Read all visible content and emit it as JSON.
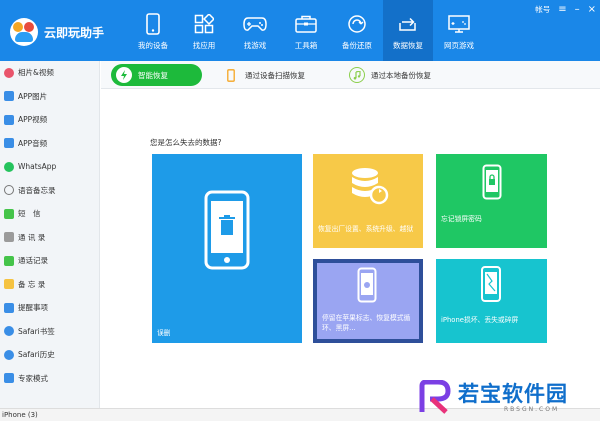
{
  "app": {
    "title": "云即玩助手"
  },
  "window": {
    "account_label": "帐号"
  },
  "nav": [
    {
      "label": "我的设备",
      "icon": "phone-icon"
    },
    {
      "label": "找应用",
      "icon": "apps-icon"
    },
    {
      "label": "找游戏",
      "icon": "gamepad-icon"
    },
    {
      "label": "工具箱",
      "icon": "toolbox-icon"
    },
    {
      "label": "备份还原",
      "icon": "backup-icon"
    },
    {
      "label": "数据恢复",
      "icon": "recover-icon"
    },
    {
      "label": "网页游戏",
      "icon": "monitor-icon"
    }
  ],
  "sidebar": [
    {
      "label": "相片&视频",
      "color": "#e9546b"
    },
    {
      "label": "APP图片",
      "color": "#3a8ee6"
    },
    {
      "label": "APP视频",
      "color": "#3a8ee6"
    },
    {
      "label": "APP音频",
      "color": "#3a8ee6"
    },
    {
      "label": "WhatsApp",
      "color": "#25c35d"
    },
    {
      "label": "语音备忘录",
      "color": "#777777"
    },
    {
      "label": "短　信",
      "color": "#45c44a"
    },
    {
      "label": "通 讯 录",
      "color": "#9b9b9b"
    },
    {
      "label": "通话记录",
      "color": "#45c44a"
    },
    {
      "label": "备 忘 录",
      "color": "#f5c342"
    },
    {
      "label": "提醒事项",
      "color": "#3a8ee6"
    },
    {
      "label": "Safari书签",
      "color": "#3a8ee6"
    },
    {
      "label": "Safari历史",
      "color": "#3a8ee6"
    },
    {
      "label": "专家模式",
      "color": "#3a8ee6"
    }
  ],
  "tabs": [
    {
      "label": "智能恢复"
    },
    {
      "label": "通过设备扫描恢复"
    },
    {
      "label": "通过本地备份恢复"
    }
  ],
  "main": {
    "question": "您是怎么失去的数据?",
    "tiles": [
      {
        "text": "误删"
      },
      {
        "text": "恢复出厂设置、系统升级、越狱"
      },
      {
        "text": "忘记锁屏密码"
      },
      {
        "text": "停留在苹果标志、恢复模式循环、黑屏..."
      },
      {
        "text": "iPhone损坏、丢失或碎屏"
      }
    ]
  },
  "status": {
    "device": "iPhone (3)"
  },
  "watermark": {
    "text": "若宝软件园",
    "sub": "RBSGN.COM"
  },
  "colors": {
    "header": "#1a87e8",
    "accent_green": "#1dba3b"
  }
}
